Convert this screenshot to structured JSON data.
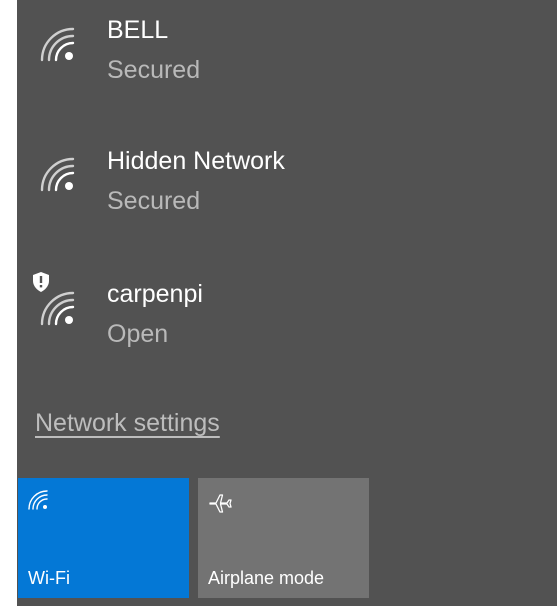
{
  "networks": [
    {
      "name": "BELL",
      "status": "Secured",
      "icon": "wifi-signal-icon",
      "warning": false
    },
    {
      "name": "Hidden Network",
      "status": "Secured",
      "icon": "wifi-signal-icon",
      "warning": false
    },
    {
      "name": "carpenpi",
      "status": "Open",
      "icon": "wifi-signal-icon",
      "warning": true
    }
  ],
  "network_settings_label": "Network settings",
  "quick_actions": {
    "wifi": {
      "label": "Wi-Fi",
      "icon": "wifi-icon",
      "active": true
    },
    "airplane": {
      "label": "Airplane mode",
      "icon": "airplane-icon",
      "active": false
    }
  },
  "colors": {
    "flyout_bg": "#525252",
    "accent": "#0478d6",
    "inactive_tile": "#737373"
  }
}
